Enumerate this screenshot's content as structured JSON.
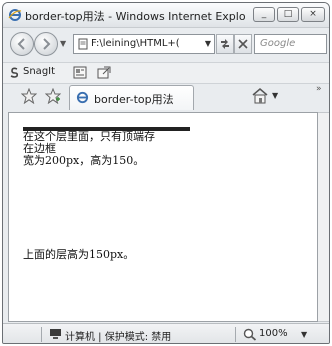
{
  "window": {
    "title": "border-top用法 - Windows Internet Explor...",
    "controls": {
      "minimize": "_",
      "maximize": "□",
      "close": "×"
    }
  },
  "nav": {
    "address": "F:\\leining\\HTML+(",
    "search_placeholder": "Google",
    "back_icon": "back-arrow-icon",
    "forward_icon": "forward-arrow-icon"
  },
  "toolbar": {
    "snagit_label": "SnagIt"
  },
  "tabs": [
    {
      "label": "border-top用法"
    }
  ],
  "page": {
    "block1_lines": [
      "在这个层里面，只有顶端存",
      "在边框",
      "宽为200px，高为150。"
    ],
    "block2_text": "上面的层高为150px。"
  },
  "status": {
    "zone": "计算机 | 保护模式: 禁用",
    "zoom": "100%"
  }
}
